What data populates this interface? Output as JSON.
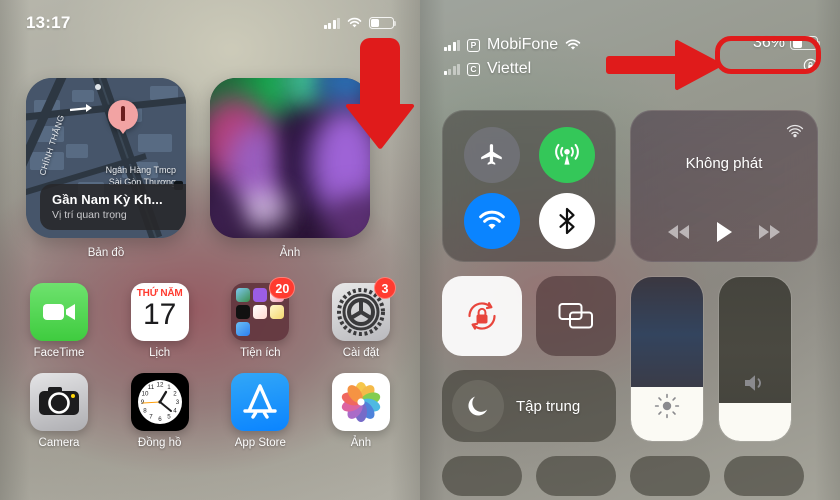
{
  "left_phone": {
    "status_bar": {
      "time": "13:17",
      "signal_icon": "cellular-bars-icon",
      "wifi_icon": "wifi-icon",
      "battery_icon": "battery-icon",
      "battery_level_pct": 36
    },
    "widgets": [
      {
        "name": "maps-widget",
        "label": "Bản đồ",
        "street_label": "CHÍNH THẮNG",
        "poi_line1": "Ngân Hàng Tmcp",
        "poi_line2": "Sài Gòn Thương",
        "card_title": "Gần Nam Kỳ Kh...",
        "card_subtitle": "Vị trí quan trọng"
      },
      {
        "name": "photos-widget",
        "label": "Ảnh"
      }
    ],
    "apps": [
      {
        "name": "facetime",
        "label": "FaceTime",
        "icon": "facetime-icon",
        "badge": null
      },
      {
        "name": "calendar",
        "label": "Lịch",
        "icon": "calendar-icon",
        "badge": null,
        "weekday": "THỨ NĂM",
        "day": "17"
      },
      {
        "name": "utilities-folder",
        "label": "Tiện ích",
        "icon": "folder-icon",
        "badge": "20"
      },
      {
        "name": "settings",
        "label": "Cài đặt",
        "icon": "gear-icon",
        "badge": "3"
      },
      {
        "name": "camera",
        "label": "Camera",
        "icon": "camera-icon",
        "badge": null
      },
      {
        "name": "clock",
        "label": "Đồng hồ",
        "icon": "clock-icon",
        "badge": null
      },
      {
        "name": "app-store",
        "label": "App Store",
        "icon": "appstore-icon",
        "badge": null
      },
      {
        "name": "photos",
        "label": "Ảnh",
        "icon": "photos-icon",
        "badge": null
      }
    ]
  },
  "right_phone": {
    "status_bar": {
      "carriers": [
        {
          "name": "MobiFone",
          "sim_badge": "P",
          "bars": 3,
          "wifi_icon": "wifi-icon"
        },
        {
          "name": "Viettel",
          "sim_badge": "C",
          "bars": 1,
          "wifi_icon": null
        }
      ],
      "battery_percent": "36%",
      "battery_level_pct": 36,
      "rotation_lock_icon": "rotation-lock-icon"
    },
    "control_center": {
      "connectivity": [
        {
          "name": "airplane-mode",
          "icon": "airplane-icon",
          "active": false,
          "color": "#76767f"
        },
        {
          "name": "cellular-data",
          "icon": "cellular-antenna-icon",
          "active": true,
          "color": "#34c759"
        },
        {
          "name": "wifi",
          "icon": "wifi-icon",
          "active": true,
          "color": "#0a84ff"
        },
        {
          "name": "bluetooth",
          "icon": "bluetooth-icon",
          "active": false,
          "color": "#ffffff"
        }
      ],
      "media": {
        "title": "Không phát",
        "airplay_icon": "airplay-icon",
        "rewind_icon": "rewind-icon",
        "play_icon": "play-icon",
        "forward_icon": "forward-icon"
      },
      "rotation_lock": {
        "name": "rotation-lock",
        "icon": "rotation-lock-icon",
        "active": true
      },
      "screen_mirroring": {
        "name": "screen-mirroring",
        "icon": "screen-mirroring-icon",
        "active": false
      },
      "focus": {
        "label": "Tập trung",
        "icon": "moon-icon",
        "active": false
      },
      "brightness": {
        "name": "brightness-slider",
        "icon": "brightness-icon",
        "value_pct": 33
      },
      "volume": {
        "name": "volume-slider",
        "icon": "speaker-icon",
        "value_pct": 23
      }
    }
  },
  "annotations": {
    "down_arrow": {
      "name": "annotation-arrow-down",
      "color": "#e01b1b"
    },
    "right_arrow": {
      "name": "annotation-arrow-right",
      "color": "#e01b1b"
    },
    "highlight_box": {
      "name": "annotation-highlight-battery",
      "color": "#e01b1b"
    }
  }
}
